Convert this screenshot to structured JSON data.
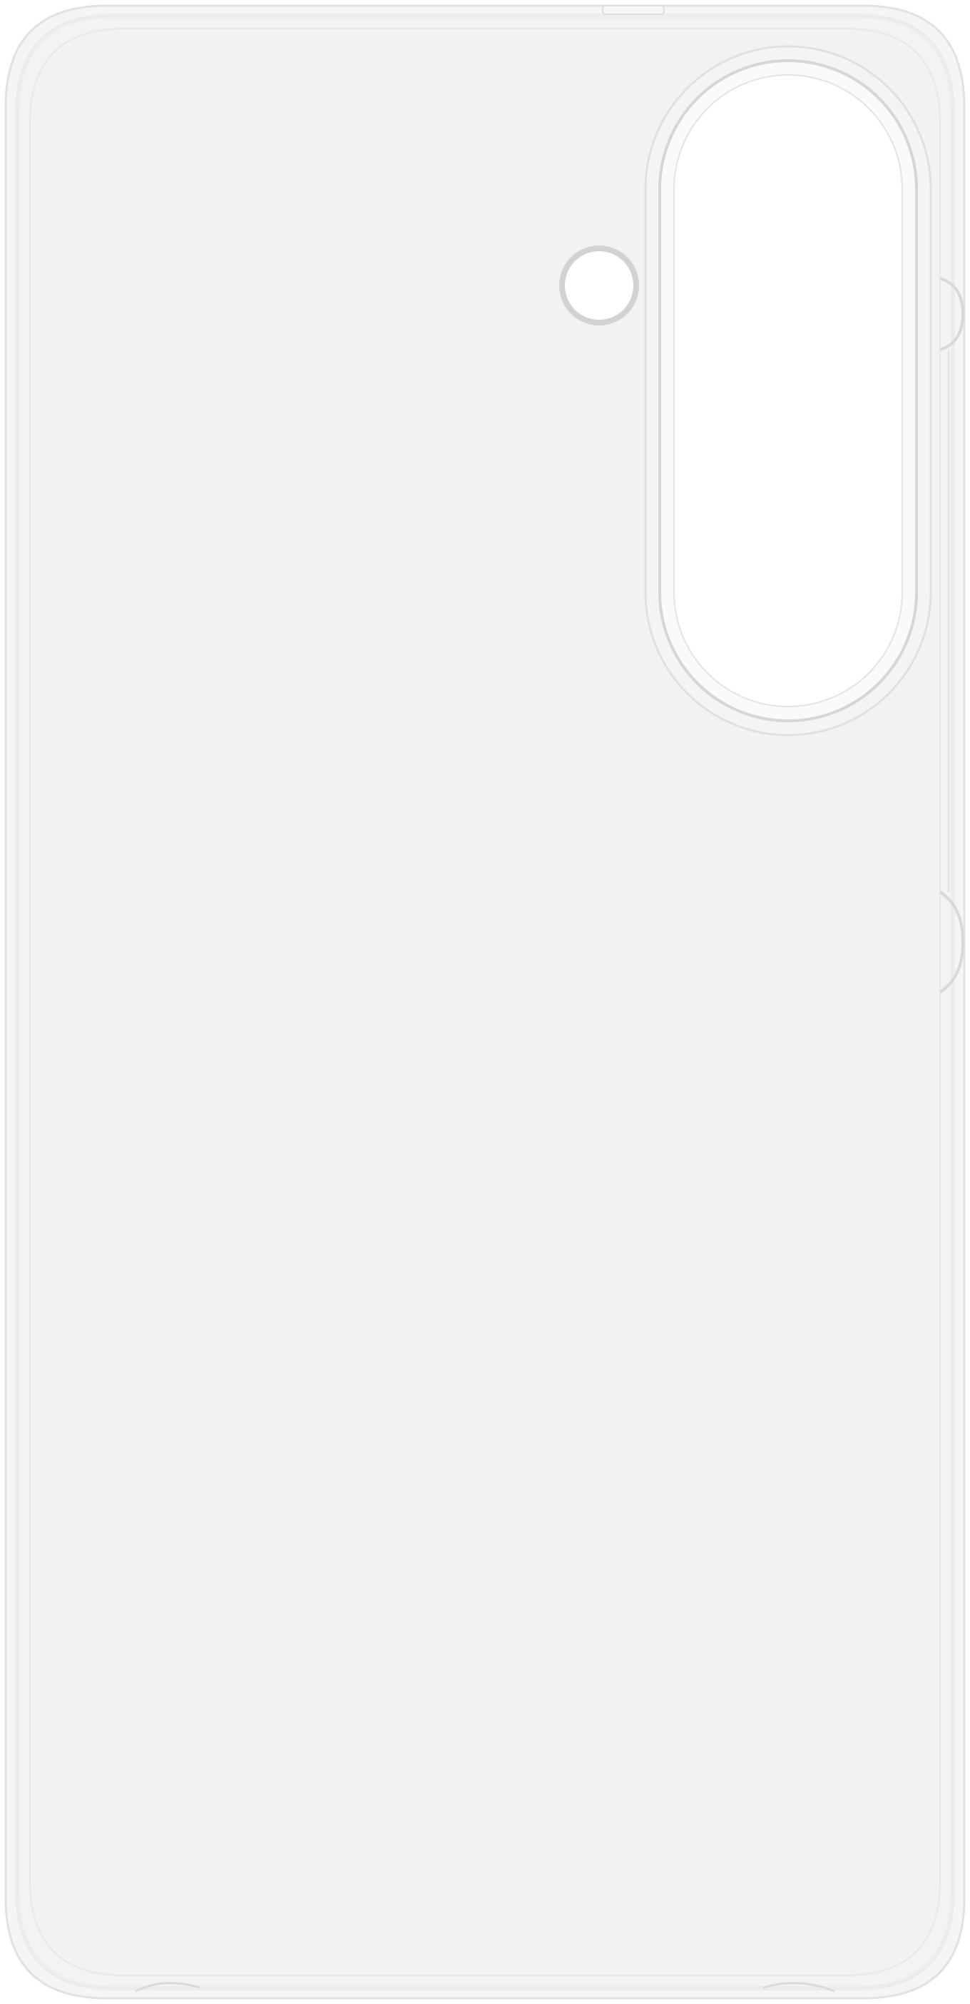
{
  "product": {
    "subject": "clear-phone-case-back-view",
    "colors": {
      "background": "#ffffff",
      "case_fill": "#f3f3f3",
      "case_edge": "#e6e6e6",
      "rim_highlight": "#fbfbfb",
      "rim_line": "#d9d9d9",
      "camera_cutout_fill": "#ffffff",
      "camera_ring": "#dcdcdc",
      "flash_ring": "#d4d4d4"
    },
    "parts": [
      "case-shell",
      "camera-cutout",
      "flash-hole",
      "side-button-cutout-upper",
      "side-button-cutout-lower"
    ]
  }
}
